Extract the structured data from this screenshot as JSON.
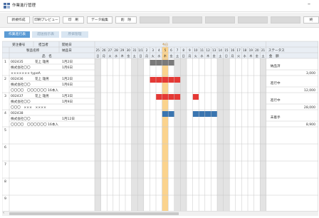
{
  "window": {
    "title": "作業進行管理",
    "min_glyph": "–"
  },
  "toolbar": {
    "buttons": [
      "新規作成",
      "印刷プレビュー",
      "印　刷",
      "データ編集",
      "削　除",
      "",
      "",
      "",
      "",
      ""
    ],
    "trailing_label": "終"
  },
  "tabs": [
    "作業進行表",
    "週送指示表",
    "原価管理"
  ],
  "header": {
    "col_order_no": "受注番号",
    "col_person": "担当者",
    "col_start": "開始日",
    "col_product_name": "製品名称",
    "col_delivery": "納品日",
    "col_item_name": "品　名",
    "col_status": "ステータス",
    "col_amount": "金　額",
    "today_label": "今日",
    "dates": [
      "25",
      "26",
      "27",
      "28",
      "29",
      "30",
      "31",
      "1/1",
      "2",
      "3",
      "4",
      "5",
      "6",
      "7",
      "8",
      "9",
      "10",
      "11",
      "12",
      "13",
      "14",
      "15",
      "16",
      "17",
      "18",
      "19",
      "20",
      "21"
    ],
    "weekdays": [
      "日",
      "月",
      "火",
      "水",
      "木",
      "金",
      "土",
      "日",
      "月",
      "火",
      "水",
      "木",
      "金",
      "土",
      "日",
      "月",
      "火",
      "水",
      "木",
      "金",
      "土",
      "日",
      "月",
      "火",
      "水",
      "木",
      "金",
      "土"
    ]
  },
  "rows": [
    {
      "num": "1",
      "order_no": "002435",
      "person": "花上 雄男",
      "start": "1月2日",
      "product": "株式会社〇〇",
      "delivery": "1月6日",
      "item": "××××××× typeA",
      "status": "納品済",
      "amount": "3,000",
      "bar_start": 9,
      "bar_len": 4,
      "bar_color": "#7a7a7a"
    },
    {
      "num": "2",
      "order_no": "002436",
      "person": "花上 雄男",
      "start": "1月2日",
      "product": "株式会社〇〇",
      "delivery": "1月6日",
      "item": "〇〇〇〇　〇〇〇〇〇〇 16本入",
      "status": "進行中",
      "amount": "12,000",
      "bar_start": 9,
      "bar_len": 5,
      "bar_color": "#e53935"
    },
    {
      "num": "3",
      "order_no": "002437",
      "person": "花上 雄男",
      "start": "1月3日",
      "product": "株式会社〇〇",
      "delivery": "1月9日",
      "item": "〇〇〇　×××　××××",
      "status": "進行中",
      "amount": "28,000",
      "bar_start": 10,
      "bar_len": 4,
      "bar_color": "#e53935",
      "bar2_start": 16,
      "bar2_len": 1,
      "bar2_color": "#e53935"
    },
    {
      "num": "4",
      "order_no": "002438",
      "person": "",
      "start": "",
      "product": "株式会社〇〇",
      "delivery": "1月12日",
      "item": "〇〇〇〇　〇〇〇〇〇〇 16本入",
      "status": "未着手",
      "amount": "8,900",
      "bar_start": 11,
      "bar_len": 2,
      "bar_color": "#3a75b0",
      "bar2_start": 16,
      "bar2_len": 4,
      "bar2_color": "#3a75b0"
    },
    {
      "num": "5"
    },
    {
      "num": "6"
    },
    {
      "num": "7"
    },
    {
      "num": "8"
    },
    {
      "num": "9"
    }
  ],
  "colors": {
    "today": "#fbd38d",
    "weekend": "#e3e3e3",
    "selected_tab": "#5b9bd5"
  }
}
